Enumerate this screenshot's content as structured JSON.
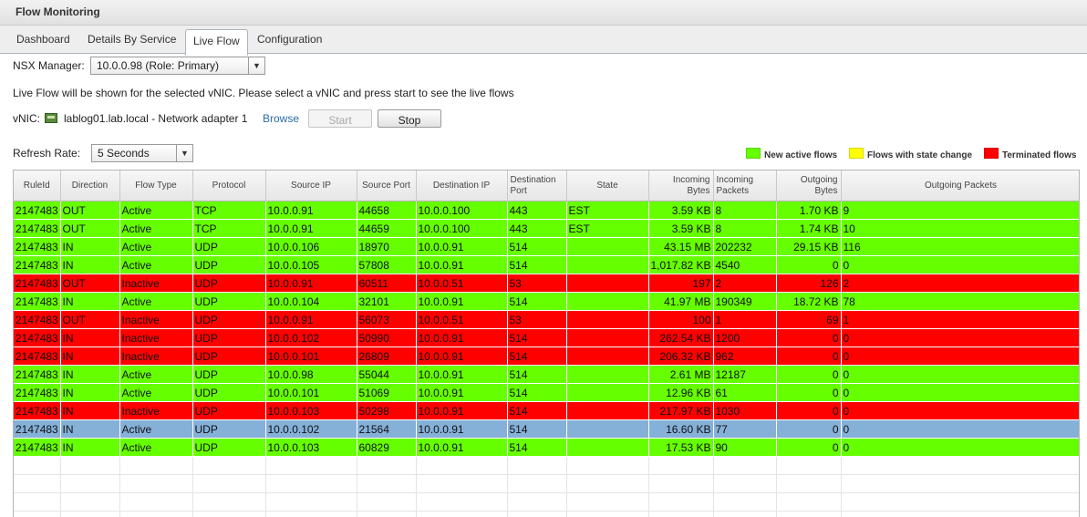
{
  "window": {
    "title": "Flow Monitoring"
  },
  "tabs": [
    {
      "label": "Dashboard"
    },
    {
      "label": "Details By Service"
    },
    {
      "label": "Live Flow"
    },
    {
      "label": "Configuration"
    }
  ],
  "nsx_manager": {
    "label": "NSX Manager:",
    "value": "10.0.0.98 (Role: Primary)"
  },
  "info_text": "Live Flow will be shown for the selected vNIC. Please select a vNIC and press start to see the live flows",
  "vnic": {
    "label": "vNIC:",
    "value": "lablog01.lab.local - Network adapter 1",
    "browse_label": "Browse",
    "start_label": "Start",
    "stop_label": "Stop"
  },
  "refresh": {
    "label": "Refresh Rate:",
    "value": "5 Seconds"
  },
  "legend": [
    {
      "label": "New active flows",
      "color": "#66ff00"
    },
    {
      "label": "Flows with state change",
      "color": "#ffff00"
    },
    {
      "label": "Terminated flows",
      "color": "#ff0000"
    }
  ],
  "table": {
    "headers": [
      "RuleId",
      "Direction",
      "Flow Type",
      "Protocol",
      "Source IP",
      "Source Port",
      "Destination IP",
      "Destination Port",
      "State",
      "Incoming Bytes",
      "Incoming Packets",
      "Outgoing Bytes",
      "Outgoing Packets"
    ],
    "rows": [
      {
        "status": "active",
        "cells": [
          "2147483",
          "OUT",
          "Active",
          "TCP",
          "10.0.0.91",
          "44658",
          "10.0.0.100",
          "443",
          "EST",
          "3.59 KB",
          "8",
          "1.70 KB",
          "9"
        ]
      },
      {
        "status": "active",
        "cells": [
          "2147483",
          "OUT",
          "Active",
          "TCP",
          "10.0.0.91",
          "44659",
          "10.0.0.100",
          "443",
          "EST",
          "3.59 KB",
          "8",
          "1.74 KB",
          "10"
        ]
      },
      {
        "status": "active",
        "cells": [
          "2147483",
          "IN",
          "Active",
          "UDP",
          "10.0.0.106",
          "18970",
          "10.0.0.91",
          "514",
          "",
          "43.15 MB",
          "202232",
          "29.15 KB",
          "116"
        ]
      },
      {
        "status": "active",
        "cells": [
          "2147483",
          "IN",
          "Active",
          "UDP",
          "10.0.0.105",
          "57808",
          "10.0.0.91",
          "514",
          "",
          "1,017.82 KB",
          "4540",
          "0",
          "0"
        ]
      },
      {
        "status": "terminated",
        "cells": [
          "2147483",
          "OUT",
          "Inactive",
          "UDP",
          "10.0.0.91",
          "60511",
          "10.0.0.51",
          "53",
          "",
          "197",
          "2",
          "126",
          "2"
        ]
      },
      {
        "status": "active",
        "cells": [
          "2147483",
          "IN",
          "Active",
          "UDP",
          "10.0.0.104",
          "32101",
          "10.0.0.91",
          "514",
          "",
          "41.97 MB",
          "190349",
          "18.72 KB",
          "78"
        ]
      },
      {
        "status": "terminated",
        "cells": [
          "2147483",
          "OUT",
          "Inactive",
          "UDP",
          "10.0.0.91",
          "56073",
          "10.0.0.51",
          "53",
          "",
          "100",
          "1",
          "69",
          "1"
        ]
      },
      {
        "status": "terminated",
        "cells": [
          "2147483",
          "IN",
          "Inactive",
          "UDP",
          "10.0.0.102",
          "50990",
          "10.0.0.91",
          "514",
          "",
          "262.54 KB",
          "1200",
          "0",
          "0"
        ]
      },
      {
        "status": "terminated",
        "cells": [
          "2147483",
          "IN",
          "Inactive",
          "UDP",
          "10.0.0.101",
          "26809",
          "10.0.0.91",
          "514",
          "",
          "206.32 KB",
          "962",
          "0",
          "0"
        ]
      },
      {
        "status": "active",
        "cells": [
          "2147483",
          "IN",
          "Active",
          "UDP",
          "10.0.0.98",
          "55044",
          "10.0.0.91",
          "514",
          "",
          "2.61 MB",
          "12187",
          "0",
          "0"
        ]
      },
      {
        "status": "active",
        "cells": [
          "2147483",
          "IN",
          "Active",
          "UDP",
          "10.0.0.101",
          "51069",
          "10.0.0.91",
          "514",
          "",
          "12.96 KB",
          "61",
          "0",
          "0"
        ]
      },
      {
        "status": "terminated",
        "cells": [
          "2147483",
          "IN",
          "Inactive",
          "UDP",
          "10.0.0.103",
          "50298",
          "10.0.0.91",
          "514",
          "",
          "217.97 KB",
          "1030",
          "0",
          "0"
        ]
      },
      {
        "status": "selected",
        "cells": [
          "2147483",
          "IN",
          "Active",
          "UDP",
          "10.0.0.102",
          "21564",
          "10.0.0.91",
          "514",
          "",
          "16.60 KB",
          "77",
          "0",
          "0"
        ]
      },
      {
        "status": "active",
        "cells": [
          "2147483",
          "IN",
          "Active",
          "UDP",
          "10.0.0.103",
          "60829",
          "10.0.0.91",
          "514",
          "",
          "17.53 KB",
          "90",
          "0",
          "0"
        ]
      }
    ]
  }
}
